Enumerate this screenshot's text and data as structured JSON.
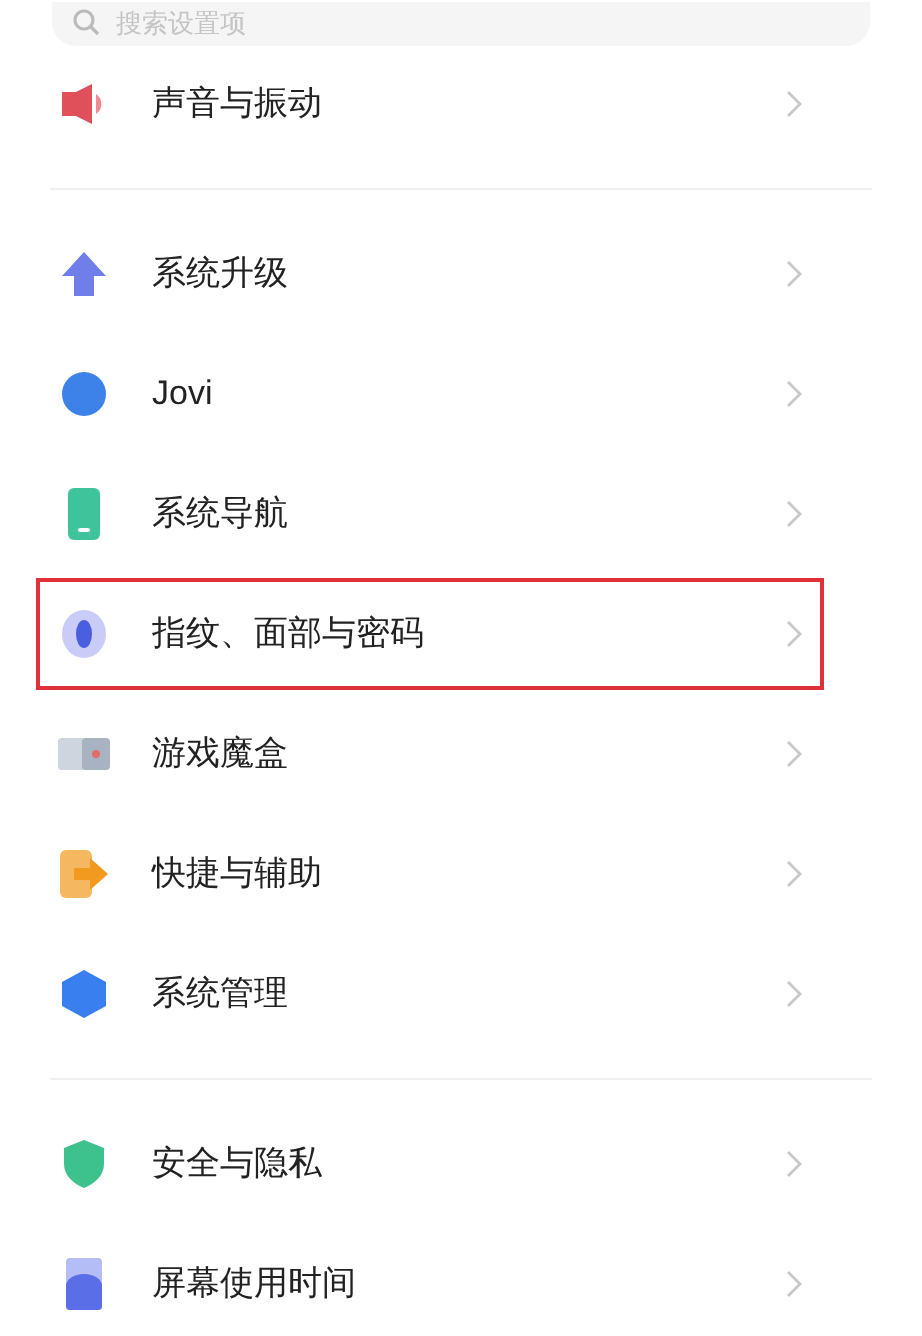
{
  "search": {
    "placeholder": "搜索设置项"
  },
  "groups": [
    {
      "items": [
        {
          "label": "声音与振动",
          "highlighted": false
        }
      ]
    },
    {
      "items": [
        {
          "label": "系统升级",
          "highlighted": false
        },
        {
          "label": "Jovi",
          "highlighted": false
        },
        {
          "label": "系统导航",
          "highlighted": false
        },
        {
          "label": "指纹、面部与密码",
          "highlighted": true
        },
        {
          "label": "游戏魔盒",
          "highlighted": false
        },
        {
          "label": "快捷与辅助",
          "highlighted": false
        },
        {
          "label": "系统管理",
          "highlighted": false
        }
      ]
    },
    {
      "items": [
        {
          "label": "安全与隐私",
          "highlighted": false
        },
        {
          "label": "屏幕使用时间",
          "highlighted": false
        }
      ]
    }
  ]
}
